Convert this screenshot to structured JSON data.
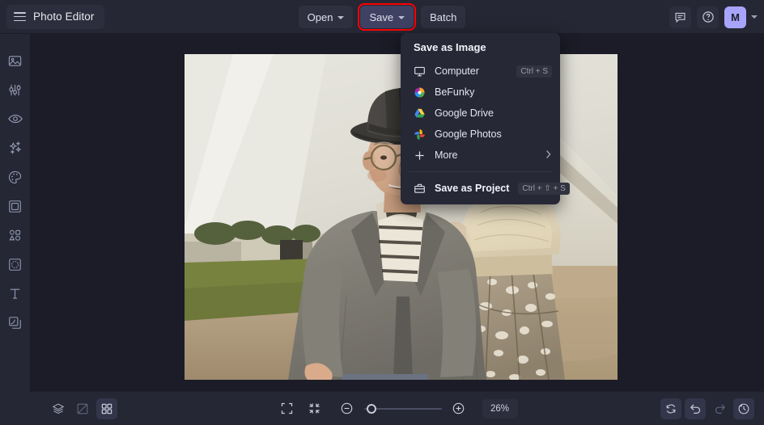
{
  "header": {
    "brand_label": "Photo Editor",
    "menu_icon": "hamburger-icon",
    "buttons": [
      {
        "label": "Open",
        "icon": "chevron-down-icon",
        "state": "normal"
      },
      {
        "label": "Save",
        "icon": "chevron-down-icon",
        "state": "active-highlighted"
      },
      {
        "label": "Batch",
        "icon": "",
        "state": "normal"
      }
    ],
    "right": {
      "feedback_icon": "speech-bubble-icon",
      "help_icon": "question-circle-icon",
      "avatar_initial": "M",
      "avatar_color": "#a8a4fb",
      "account_caret_icon": "chevron-down-icon"
    }
  },
  "sidebar": {
    "items": [
      {
        "name": "image",
        "icon": "image-icon"
      },
      {
        "name": "edit",
        "icon": "sliders-icon"
      },
      {
        "name": "touch-up",
        "icon": "eye-icon"
      },
      {
        "name": "effects",
        "icon": "sparkles-icon"
      },
      {
        "name": "artsy",
        "icon": "palette-icon"
      },
      {
        "name": "frames",
        "icon": "frame-icon"
      },
      {
        "name": "graphics",
        "icon": "shapes-icon"
      },
      {
        "name": "overlays",
        "icon": "overlay-icon"
      },
      {
        "name": "text",
        "icon": "text-t-icon"
      },
      {
        "name": "textures",
        "icon": "layers-overlap-icon"
      }
    ]
  },
  "save_menu": {
    "title": "Save as Image",
    "items": [
      {
        "label": "Computer",
        "icon": "monitor-icon",
        "shortcut": "Ctrl + S",
        "submenu": false
      },
      {
        "label": "BeFunky",
        "icon": "befunky-logo-icon",
        "shortcut": "",
        "submenu": false
      },
      {
        "label": "Google Drive",
        "icon": "google-drive-icon",
        "shortcut": "",
        "submenu": false
      },
      {
        "label": "Google Photos",
        "icon": "google-photos-icon",
        "shortcut": "",
        "submenu": false
      },
      {
        "label": "More",
        "icon": "plus-icon",
        "shortcut": "",
        "submenu": true
      }
    ],
    "project": {
      "label": "Save as Project",
      "icon": "briefcase-icon",
      "shortcut": "Ctrl + ⇧ + S"
    }
  },
  "canvas": {
    "photo_alt": "colorized vintage photograph of an elderly man in hat and glasses with a woman"
  },
  "bottom_bar": {
    "left_tools": [
      {
        "name": "layers",
        "icon": "layers-stack-icon",
        "active": false
      },
      {
        "name": "compare",
        "icon": "compare-split-icon",
        "active": false
      },
      {
        "name": "grid-view",
        "icon": "grid-four-squares-icon",
        "active": true
      }
    ],
    "zoom": {
      "fit_icon": "expand-corners-icon",
      "actual_icon": "collapse-corners-icon",
      "zoom_out_icon": "minus-circle-icon",
      "zoom_in_icon": "plus-circle-icon",
      "value": "26%",
      "slider_position_pct": 4
    },
    "right_tools": [
      {
        "name": "reset",
        "icon": "reset-circular-arrows-icon",
        "disabled": false
      },
      {
        "name": "undo",
        "icon": "undo-arrow-icon",
        "disabled": false
      },
      {
        "name": "redo",
        "icon": "redo-arrow-icon",
        "disabled": true
      },
      {
        "name": "history",
        "icon": "history-clock-icon",
        "disabled": false
      }
    ]
  },
  "colors": {
    "header_bg": "#252734",
    "canvas_bg": "#1b1c27",
    "menu_bg": "#272836",
    "accent": "#a8a4fb",
    "highlight_outline": "#fe0000",
    "save_btn_bg": "#3f4163"
  }
}
